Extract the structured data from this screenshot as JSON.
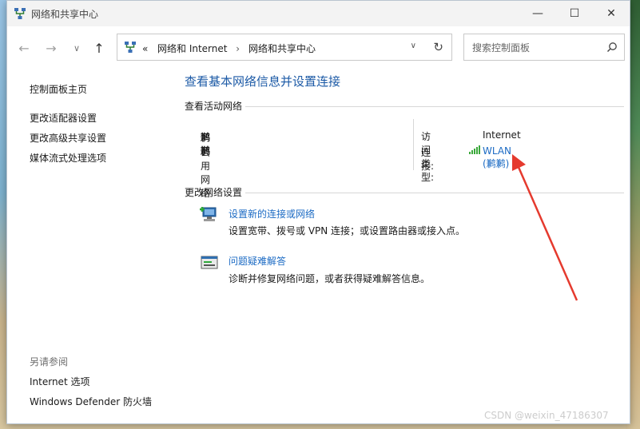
{
  "window": {
    "title": "网络和共享中心"
  },
  "controls": {
    "minimize": "—",
    "maximize": "☐",
    "close": "✕"
  },
  "nav": {
    "back": "←",
    "forward": "→",
    "history": "∨",
    "up": "↑"
  },
  "address": {
    "overflow": "«",
    "crumbs": [
      "网络和 Internet",
      "网络和共享中心"
    ],
    "separator": "›",
    "dropdown": "∨",
    "refresh": "↻"
  },
  "search": {
    "placeholder": "搜索控制面板"
  },
  "sidebar": {
    "items": [
      "控制面板主页",
      "更改适配器设置",
      "更改高级共享设置",
      "媒体流式处理选项"
    ],
    "see_also_title": "另请参阅",
    "see_also": [
      "Internet 选项",
      "Windows Defender 防火墙"
    ]
  },
  "main": {
    "title": "查看基本网络信息并设置连接",
    "active_section": "查看活动网络",
    "network": {
      "name": "鹣鹣",
      "type": "公用网络",
      "access_label": "访问类型:",
      "access_value": "Internet",
      "conn_label": "连接:",
      "conn_value": "WLAN (鹣鹣)"
    },
    "change_section": "更改网络设置",
    "tasks": [
      {
        "title": "设置新的连接或网络",
        "desc": "设置宽带、拨号或 VPN 连接；或设置路由器或接入点。"
      },
      {
        "title": "问题疑难解答",
        "desc": "诊断并修复网络问题，或者获得疑难解答信息。"
      }
    ]
  },
  "watermark": "CSDN @weixin_47186307",
  "colors": {
    "link": "#1c6bc4",
    "title": "#1c5aa6",
    "annotation_arrow": "#e53a2e"
  }
}
